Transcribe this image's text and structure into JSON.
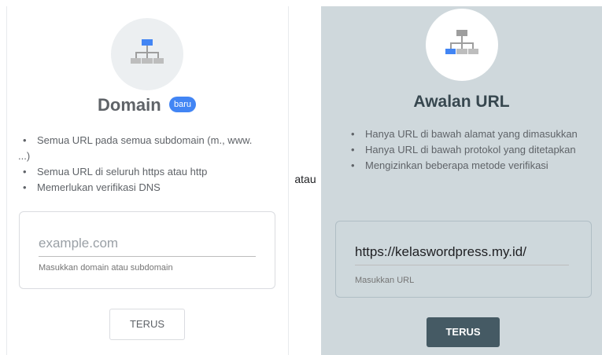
{
  "domain_option": {
    "title": "Domain",
    "badge": "baru",
    "features": [
      "Semua URL pada semua subdomain (m., www. ...)",
      "Semua URL di seluruh https atau http",
      "Memerlukan verifikasi DNS"
    ],
    "input_placeholder": "example.com",
    "input_value": "",
    "hint": "Masukkan domain atau subdomain",
    "button_label": "TERUS"
  },
  "separator": "atau",
  "url_prefix_option": {
    "title": "Awalan URL",
    "features": [
      "Hanya URL di bawah alamat yang dimasukkan",
      "Hanya URL di bawah protokol yang ditetapkan",
      "Mengizinkan beberapa metode verifikasi"
    ],
    "input_value": "https://kelaswordpress.my.id/",
    "hint": "Masukkan URL",
    "button_label": "TERUS"
  },
  "colors": {
    "accent_blue": "#4285f4",
    "selected_panel_bg": "#cfd8dc",
    "primary_button": "#455a64"
  },
  "icons": {
    "domain": "sitemap-icon-top-highlighted",
    "url_prefix": "sitemap-icon-bottom-left-highlighted"
  }
}
